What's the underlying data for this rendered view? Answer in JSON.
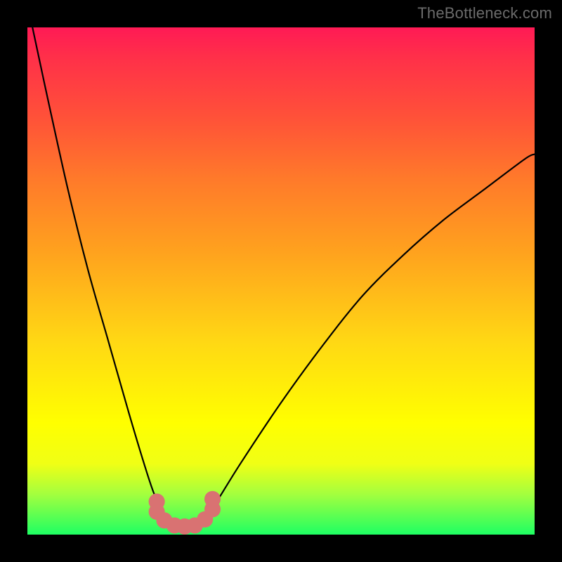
{
  "watermark": "TheBottleneck.com",
  "colors": {
    "frame": "#000000",
    "curve": "#000000",
    "dots": "#d97272",
    "gradient_stops": [
      "#ff1a55",
      "#ff3049",
      "#ff5238",
      "#ff7a2a",
      "#ffa11e",
      "#ffd814",
      "#ffff00",
      "#f0ff15",
      "#a4ff3e",
      "#1eff63"
    ]
  },
  "chart_data": {
    "type": "line",
    "title": "",
    "xlabel": "",
    "ylabel": "",
    "xlim": [
      0,
      100
    ],
    "ylim": [
      0,
      100
    ],
    "grid": false,
    "legend": false,
    "series": [
      {
        "name": "bottleneck-curve",
        "x": [
          1,
          4,
          8,
          12,
          16,
          20,
          23,
          25,
          27,
          28.5,
          30,
          32,
          34,
          37,
          42,
          50,
          58,
          66,
          74,
          82,
          90,
          98,
          100
        ],
        "y": [
          100,
          86,
          68,
          52,
          38,
          24,
          14,
          8,
          4,
          2,
          1,
          1,
          2,
          6,
          14,
          26,
          37,
          47,
          55,
          62,
          68,
          74,
          75
        ]
      }
    ],
    "markers": [
      {
        "x": 25.5,
        "y": 6.5
      },
      {
        "x": 25.5,
        "y": 4.5
      },
      {
        "x": 27.0,
        "y": 2.8
      },
      {
        "x": 29.0,
        "y": 1.8
      },
      {
        "x": 31.0,
        "y": 1.6
      },
      {
        "x": 33.0,
        "y": 1.8
      },
      {
        "x": 35.0,
        "y": 3.0
      },
      {
        "x": 36.5,
        "y": 5.0
      },
      {
        "x": 36.5,
        "y": 7.0
      }
    ],
    "marker_radius": 1.6
  }
}
